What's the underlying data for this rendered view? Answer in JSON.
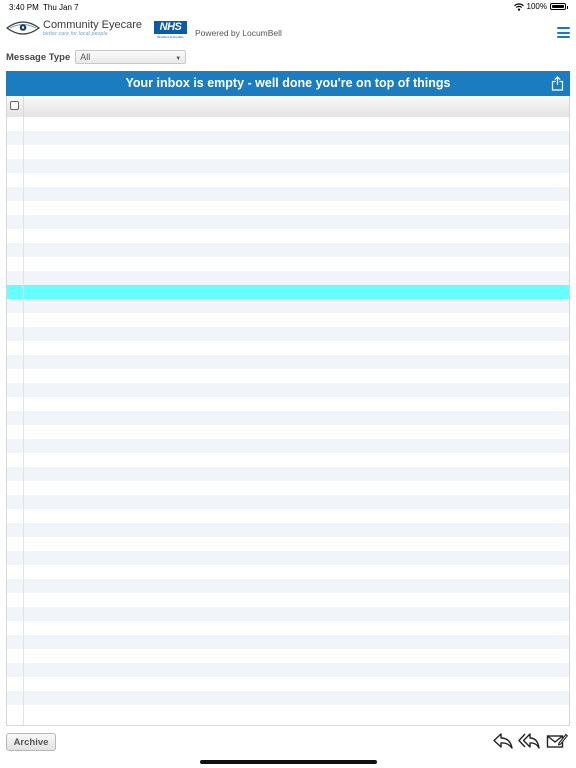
{
  "status_bar": {
    "time": "3:40 PM",
    "date": "Thu Jan 7",
    "battery": "100%"
  },
  "header": {
    "logo_title": "Community Eyecare",
    "logo_tagline": "better care for local people",
    "nhs_label": "NHS",
    "nhs_sub": "Bradford & Airedale",
    "powered_by": "Powered by LocumBell"
  },
  "filter": {
    "label": "Message Type",
    "selected": "All"
  },
  "inbox": {
    "empty_message": "Your inbox is empty - well done you're on top of things",
    "row_count": 43,
    "highlighted_row": 12
  },
  "bottom_bar": {
    "archive_label": "Archive"
  },
  "colors": {
    "accent": "#1b7dbf",
    "highlight": "#66ffff",
    "stripe": "#f1f5fa"
  }
}
